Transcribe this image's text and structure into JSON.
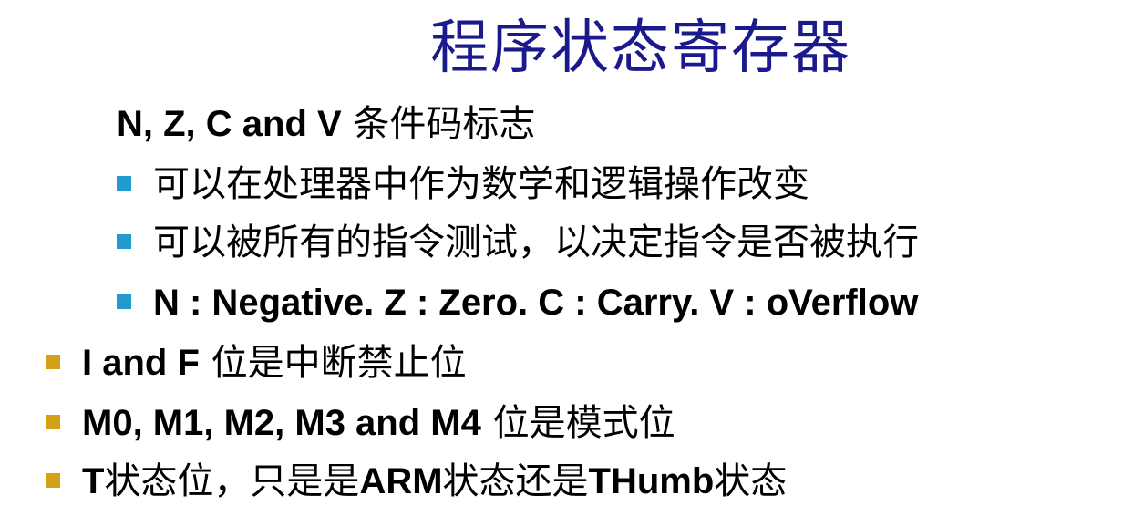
{
  "title": "程序状态寄存器",
  "colors": {
    "title": "#1a1a8c",
    "sub_bullet": "#1f9bd1",
    "top_bullet": "#d4a017",
    "text": "#000000",
    "background": "#ffffff"
  },
  "items": {
    "nzcv_heading": {
      "latin": "N, Z, C and V",
      "cjk": " 条件码标志"
    },
    "sub_bullets": [
      {
        "text": "可以在处理器中作为数学和逻辑操作改变"
      },
      {
        "text": "可以被所有的指令测试，以决定指令是否被执行"
      },
      {
        "text": "N : Negative.  Z : Zero.  C : Carry.  V : oVerflow"
      }
    ],
    "top_bullets": [
      {
        "latin": "I and F",
        "cjk": " 位是中断禁止位"
      },
      {
        "latin": "M0, M1, M2, M3 and M4",
        "cjk": " 位是模式位"
      },
      {
        "p1": "T",
        "p2": "状态位，只是是",
        "p3": "ARM",
        "p4": "状态还是",
        "p5": "THumb",
        "p6": "状态"
      }
    ]
  },
  "icons": {
    "sub_bullet": "square-bullet-icon",
    "top_bullet": "square-bullet-icon"
  }
}
